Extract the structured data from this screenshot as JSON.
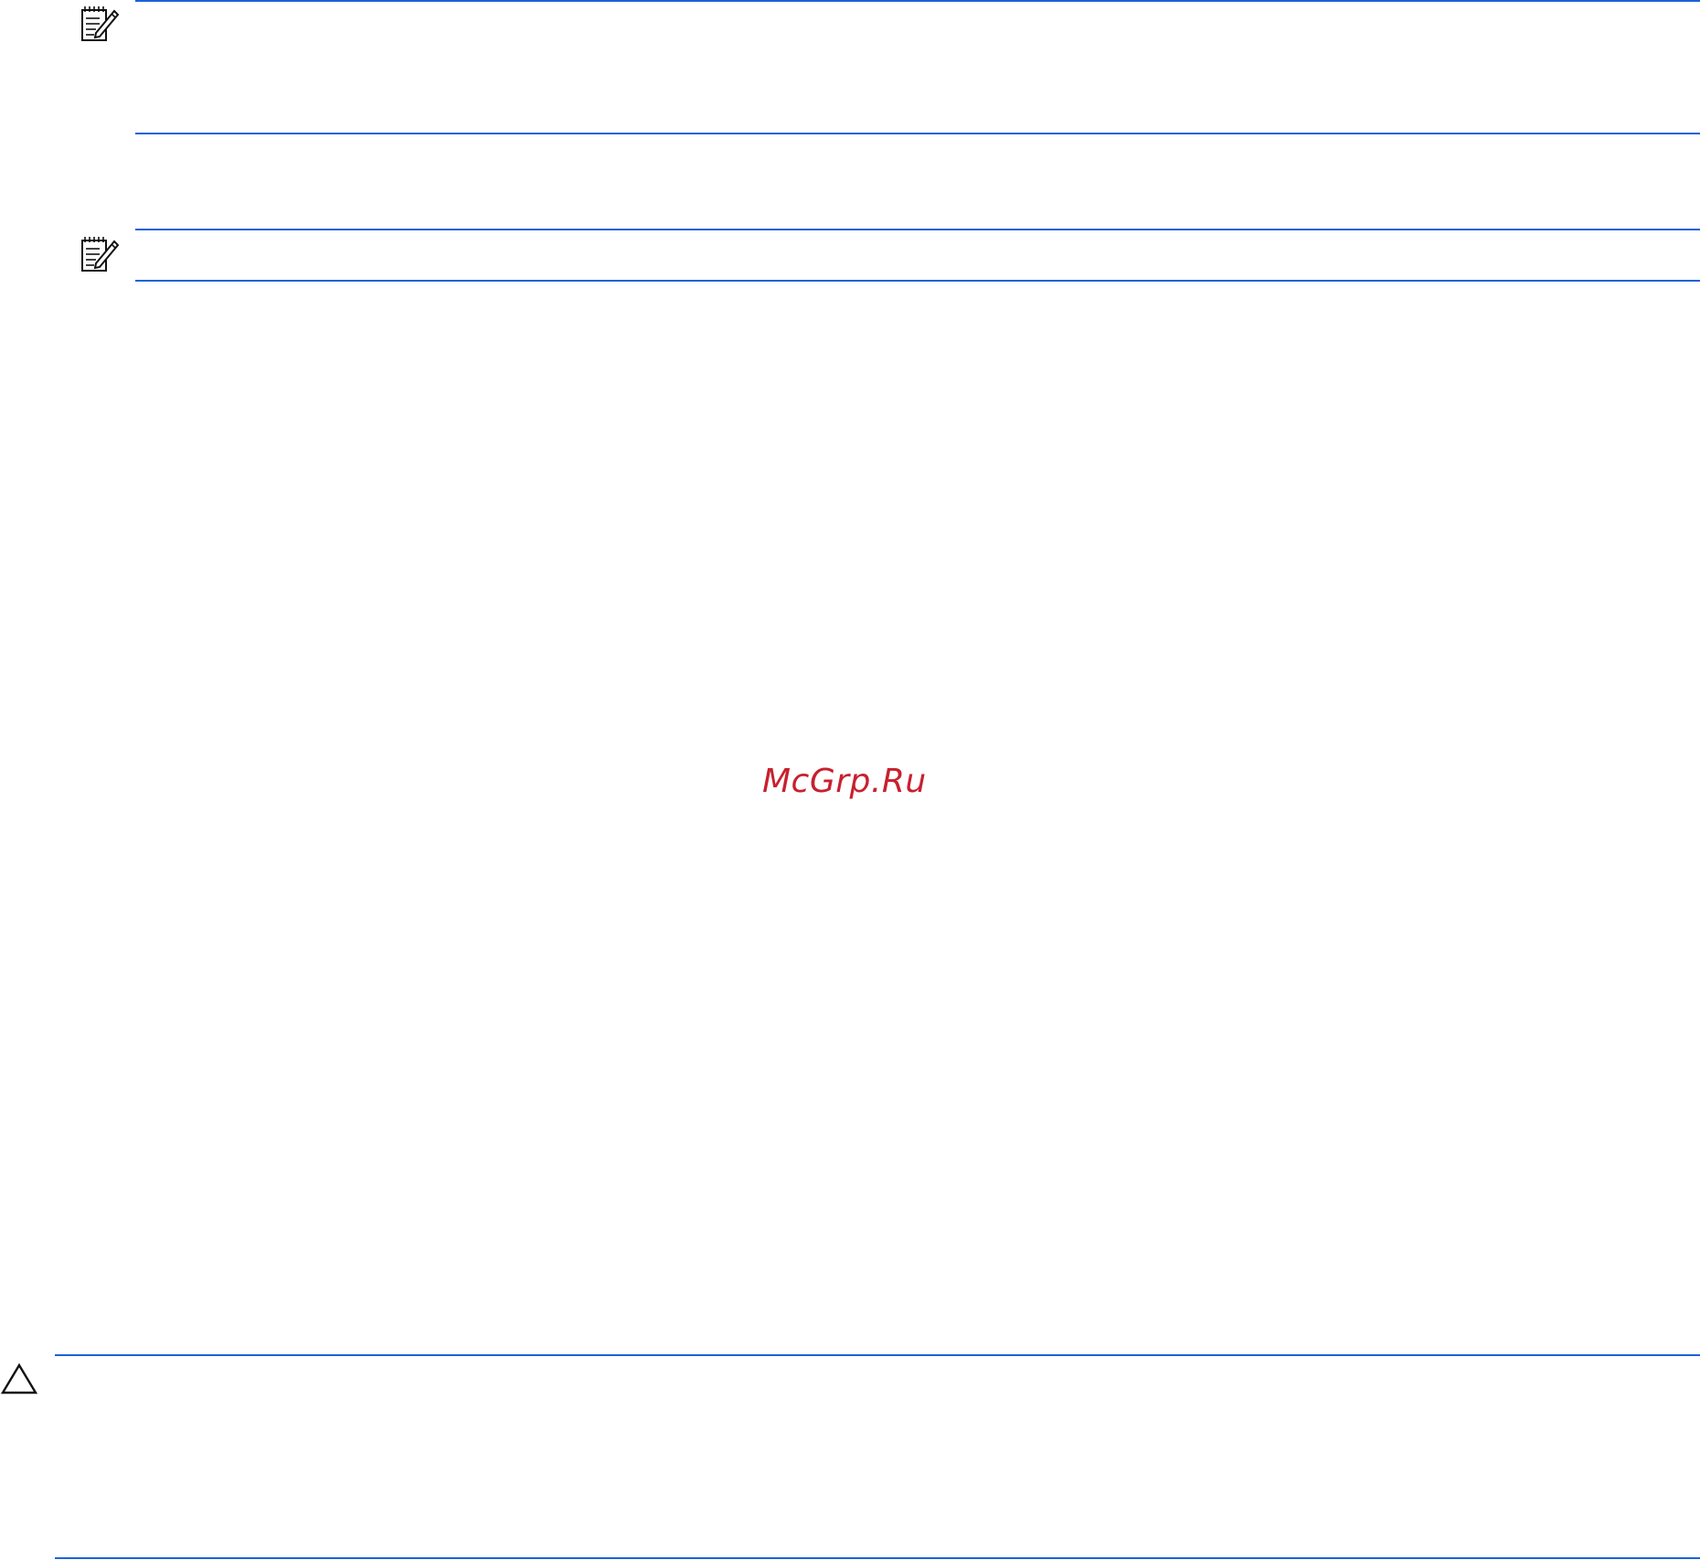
{
  "document": {
    "accent_color": "#1a63d8",
    "notes": [
      {
        "icon": "note-pencil-icon"
      },
      {
        "icon": "note-pencil-icon"
      }
    ],
    "caution": {
      "icon": "caution-triangle-icon"
    },
    "watermark": {
      "text": "McGrp.Ru",
      "color": "#c8202f"
    }
  }
}
